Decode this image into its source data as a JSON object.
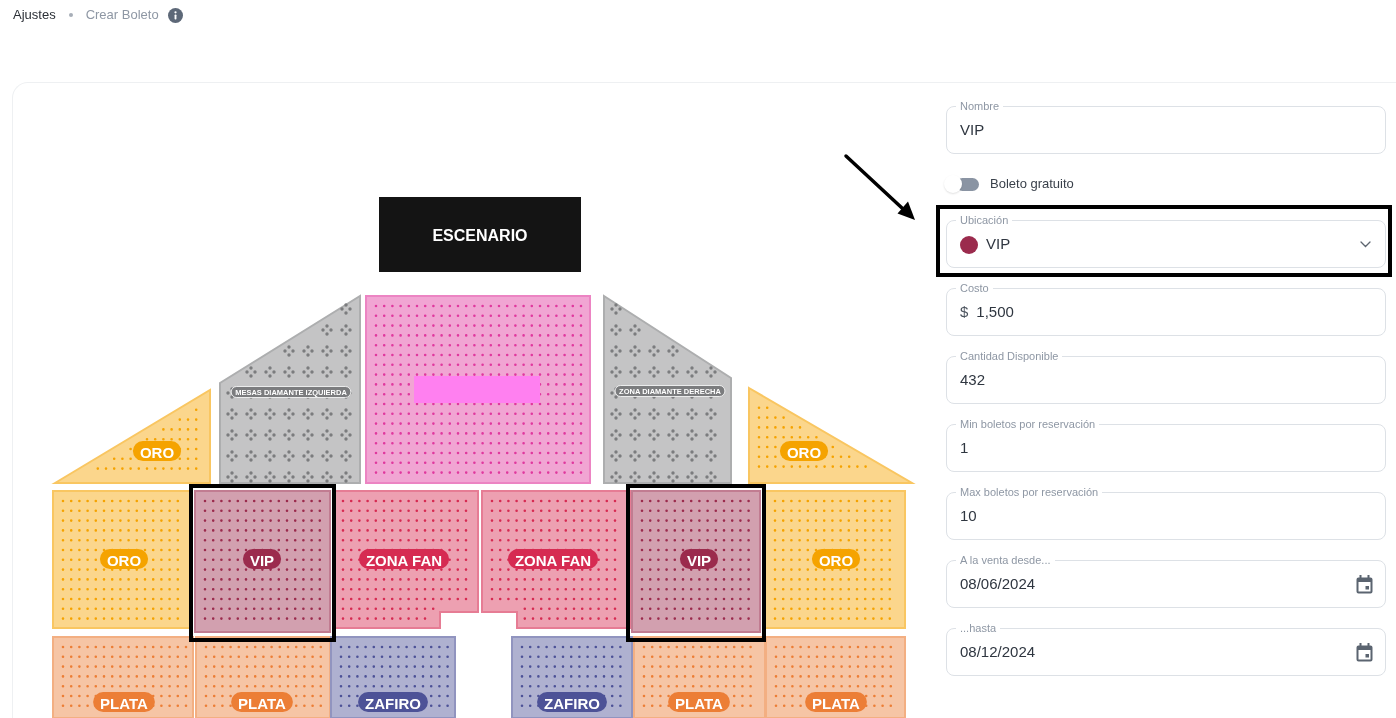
{
  "breadcrumb": [
    {
      "label": "Ajustes",
      "current": false
    },
    {
      "label": "Crear Boleto",
      "current": true
    }
  ],
  "map": {
    "stage": "ESCENARIO",
    "sections": [
      {
        "kind": "seats",
        "label": "ORO",
        "color": "#f5a300",
        "highlighted": false
      },
      {
        "kind": "tables",
        "label": "MESAS DIAMANTE IZQUIERDA",
        "color": "#7b7c7e",
        "highlighted": false
      },
      {
        "kind": "front",
        "color": "#e0389e",
        "highlighted": false
      },
      {
        "kind": "tables",
        "label": "ZONA DIAMANTE DERECHA",
        "color": "#7b7c7e",
        "highlighted": false
      },
      {
        "kind": "seats",
        "label": "ORO",
        "color": "#f5a300",
        "highlighted": false
      },
      {
        "kind": "seats",
        "label": "ORO",
        "color": "#f5a300",
        "highlighted": false
      },
      {
        "kind": "seats",
        "label": "VIP",
        "color": "#9b2b4d",
        "highlighted": true
      },
      {
        "kind": "seats",
        "label": "ZONA FAN",
        "color": "#d62b52",
        "highlighted": false
      },
      {
        "kind": "seats",
        "label": "ZONA FAN",
        "color": "#d62b52",
        "highlighted": false
      },
      {
        "kind": "seats",
        "label": "VIP",
        "color": "#9b2b4d",
        "highlighted": true
      },
      {
        "kind": "seats",
        "label": "ORO",
        "color": "#f5a300",
        "highlighted": false
      },
      {
        "kind": "seats",
        "label": "PLATA",
        "color": "#ec7e36",
        "highlighted": false
      },
      {
        "kind": "seats",
        "label": "PLATA",
        "color": "#ec7e36",
        "highlighted": false
      },
      {
        "kind": "seats",
        "label": "ZAFIRO",
        "color": "#4d5297",
        "highlighted": false
      },
      {
        "kind": "seats",
        "label": "ZAFIRO",
        "color": "#4d5297",
        "highlighted": false
      },
      {
        "kind": "seats",
        "label": "PLATA",
        "color": "#ec7e36",
        "highlighted": false
      },
      {
        "kind": "seats",
        "label": "PLATA",
        "color": "#ec7e36",
        "highlighted": false
      }
    ]
  },
  "form": {
    "fields": [
      {
        "kind": "text",
        "label": "Nombre",
        "value": "VIP",
        "highlighted": false
      },
      {
        "kind": "switch",
        "label": "Boleto gratuito",
        "on": false,
        "highlighted": false
      },
      {
        "kind": "select",
        "label": "Ubicación",
        "value": "VIP",
        "color": "#9b2b4d",
        "highlighted": true
      },
      {
        "kind": "money",
        "label": "Costo",
        "prefix": "$",
        "value": "1,500",
        "highlighted": false
      },
      {
        "kind": "text",
        "label": "Cantidad Disponible",
        "value": "432",
        "highlighted": false
      },
      {
        "kind": "text",
        "label": "Min boletos por reservación",
        "value": "1",
        "highlighted": false
      },
      {
        "kind": "text",
        "label": "Max boletos por reservación",
        "value": "10",
        "highlighted": false
      },
      {
        "kind": "date",
        "label": "A la venta desde...",
        "value": "08/06/2024",
        "highlighted": false
      },
      {
        "kind": "date",
        "label": "...hasta",
        "value": "08/12/2024",
        "highlighted": false
      }
    ]
  }
}
